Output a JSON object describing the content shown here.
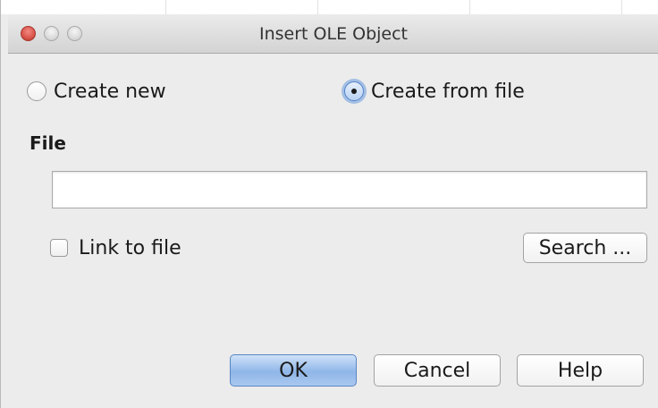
{
  "window": {
    "title": "Insert OLE Object"
  },
  "options": {
    "create_new_label": "Create new",
    "create_from_file_label": "Create from file",
    "selected": "create_from_file"
  },
  "file": {
    "label": "File",
    "value": "",
    "link_to_file_label": "Link to file",
    "link_to_file_checked": false,
    "search_button_label": "Search ..."
  },
  "buttons": {
    "ok_label": "OK",
    "cancel_label": "Cancel",
    "help_label": "Help"
  },
  "colors": {
    "dialog_background": "#ececec",
    "default_button_accent": "#8fb6e8",
    "close_button": "#d9534a"
  }
}
